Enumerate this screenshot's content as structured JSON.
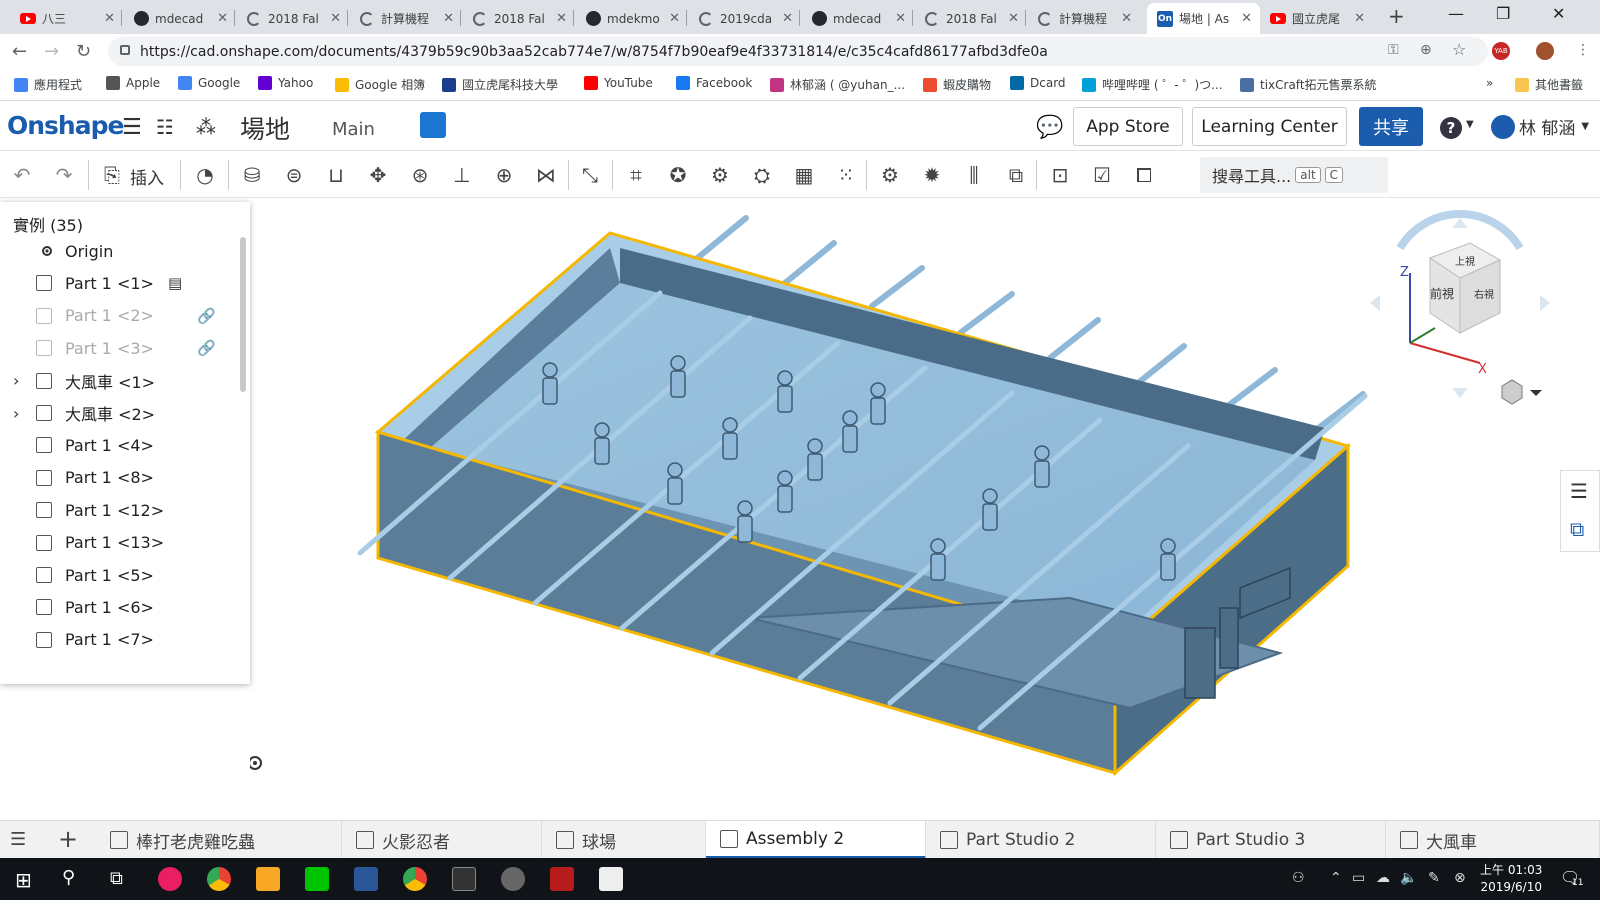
{
  "browser": {
    "tabs": [
      {
        "label": "八三",
        "icon": "youtube-icon",
        "active": false
      },
      {
        "label": "mdecad",
        "icon": "github-icon",
        "active": false
      },
      {
        "label": "2018 Fal",
        "icon": "globe-icon",
        "active": false
      },
      {
        "label": "計算機程",
        "icon": "globe-icon",
        "active": false
      },
      {
        "label": "2018 Fal",
        "icon": "globe-icon",
        "active": false
      },
      {
        "label": "mdekmo",
        "icon": "github-icon",
        "active": false
      },
      {
        "label": "2019cda",
        "icon": "globe-icon",
        "active": false
      },
      {
        "label": "mdecad",
        "icon": "github-icon",
        "active": false
      },
      {
        "label": "2018 Fal",
        "icon": "globe-icon",
        "active": false
      },
      {
        "label": "計算機程",
        "icon": "globe-icon",
        "active": false
      },
      {
        "label": "場地 | As",
        "icon": "onshape-icon",
        "active": true
      },
      {
        "label": "國立虎尾",
        "icon": "youtube-icon",
        "active": false
      }
    ],
    "url": "https://cad.onshape.com/documents/4379b59c90b3aa52cab774e7/w/8754f7b90eaf9e4f33731814/e/c35c4cafd86177afbd3dfe0a",
    "bookmarks": [
      "應用程式",
      "Apple",
      "Google",
      "Yahoo",
      "Google 相簿",
      "國立虎尾科技大學",
      "YouTube",
      "Facebook",
      "林郁涵 ( @yuhan_...",
      "蝦皮購物",
      "Dcard",
      "哔哩哔哩 ( ゜- ゜)つ...",
      "tixCraft拓元售票系統"
    ],
    "bookmark_more": "»",
    "other_bookmarks": "其他書籤",
    "ext_badge": "YAB"
  },
  "onshape": {
    "logo": "Onshape",
    "doc_name": "場地",
    "workspace": "Main",
    "app_store": "App Store",
    "learning_center": "Learning Center",
    "share": "共享",
    "help": "?",
    "user": "林 郁涵",
    "insert_label": "插入",
    "search_label": "搜尋工具...",
    "search_key1": "alt",
    "search_key2": "C"
  },
  "instances": {
    "title": "實例 (35)",
    "items": [
      {
        "label": "Origin",
        "type": "origin",
        "caret": false,
        "dim": false,
        "extra": ""
      },
      {
        "label": "Part 1 <1>",
        "type": "part",
        "caret": false,
        "dim": false,
        "extra": "fixed-icon"
      },
      {
        "label": "Part 1 <2>",
        "type": "part",
        "caret": false,
        "dim": true,
        "extra": "link-icon"
      },
      {
        "label": "Part 1 <3>",
        "type": "part",
        "caret": false,
        "dim": true,
        "extra": "link-icon"
      },
      {
        "label": "大風車 <1>",
        "type": "assembly",
        "caret": true,
        "dim": false,
        "extra": ""
      },
      {
        "label": "大風車 <2>",
        "type": "assembly",
        "caret": true,
        "dim": false,
        "extra": ""
      },
      {
        "label": "Part 1 <4>",
        "type": "part",
        "caret": false,
        "dim": false,
        "extra": ""
      },
      {
        "label": "Part 1 <8>",
        "type": "part",
        "caret": false,
        "dim": false,
        "extra": ""
      },
      {
        "label": "Part 1 <12>",
        "type": "part",
        "caret": false,
        "dim": false,
        "extra": ""
      },
      {
        "label": "Part 1 <13>",
        "type": "part",
        "caret": false,
        "dim": false,
        "extra": ""
      },
      {
        "label": "Part 1 <5>",
        "type": "part",
        "caret": false,
        "dim": false,
        "extra": ""
      },
      {
        "label": "Part 1 <6>",
        "type": "part",
        "caret": false,
        "dim": false,
        "extra": ""
      },
      {
        "label": "Part 1 <7>",
        "type": "part",
        "caret": false,
        "dim": false,
        "extra": ""
      }
    ]
  },
  "viewcube": {
    "top": "上視",
    "front": "前視",
    "right": "右視",
    "axis_z": "Z",
    "axis_x": "X"
  },
  "bottom_tabs": [
    {
      "label": "棒打老虎雞吃蟲",
      "active": false
    },
    {
      "label": "火影忍者",
      "active": false
    },
    {
      "label": "球場",
      "active": false
    },
    {
      "label": "Assembly 2",
      "active": true
    },
    {
      "label": "Part Studio 2",
      "active": false
    },
    {
      "label": "Part Studio 3",
      "active": false
    },
    {
      "label": "大風車",
      "active": false
    }
  ],
  "taskbar": {
    "time": "上午 01:03",
    "date": "2019/6/10",
    "notif": "11"
  },
  "colors": {
    "accent": "#1b5cad",
    "model": "#8fb8d8",
    "highlight": "#f5b800"
  }
}
